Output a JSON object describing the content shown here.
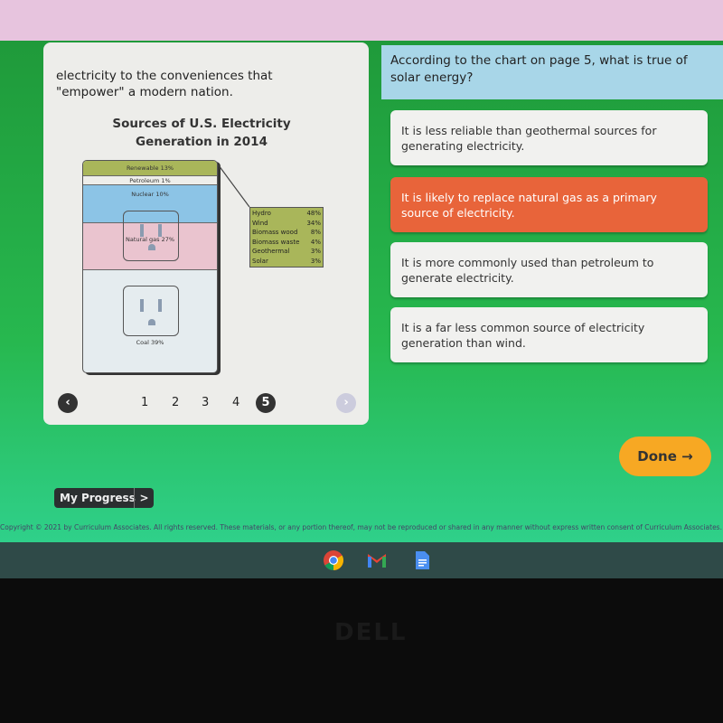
{
  "passage": {
    "text": "electricity to the conveniences that \"empower\" a modern nation."
  },
  "chart": {
    "title": "Sources of U.S. Electricity Generation in 2014",
    "bands": [
      "Renewable 13%",
      "Petroleum 1%",
      "Nuclear 10%",
      "Natural gas 27%",
      "Coal 39%"
    ],
    "renewables": [
      {
        "name": "Hydro",
        "pct": "48%"
      },
      {
        "name": "Wind",
        "pct": "34%"
      },
      {
        "name": "Biomass wood",
        "pct": "8%"
      },
      {
        "name": "Biomass waste",
        "pct": "4%"
      },
      {
        "name": "Geothermal",
        "pct": "3%"
      },
      {
        "name": "Solar",
        "pct": "3%"
      }
    ]
  },
  "pager": {
    "prev": "‹",
    "next": "›",
    "pages": [
      "1",
      "2",
      "3",
      "4",
      "5"
    ],
    "current": "5"
  },
  "question": "According to the chart on page 5, what is true of solar energy?",
  "answers": [
    {
      "text": "It is less reliable than geothermal sources for generating electricity.",
      "selected": false
    },
    {
      "text": "It is likely to replace natural gas as a primary source of electricity.",
      "selected": true
    },
    {
      "text": "It is more commonly used than petroleum to generate electricity.",
      "selected": false
    },
    {
      "text": "It is a far less common source of electricity generation than wind.",
      "selected": false
    }
  ],
  "done": {
    "label": "Done →"
  },
  "progress": {
    "label": "My Progress",
    "arrow": ">"
  },
  "copyright": "Copyright © 2021 by Curriculum Associates. All rights reserved. These materials, or any portion thereof, may not be reproduced or shared in any manner without express written consent of Curriculum Associates.",
  "taskbar": {
    "icons": [
      "chrome-icon",
      "gmail-icon",
      "docs-icon"
    ]
  },
  "bezel": {
    "logo": "DELL"
  },
  "colors": {
    "selected": "#e8643a",
    "done": "#f7a823",
    "question_bg": "#a8d6e8"
  }
}
